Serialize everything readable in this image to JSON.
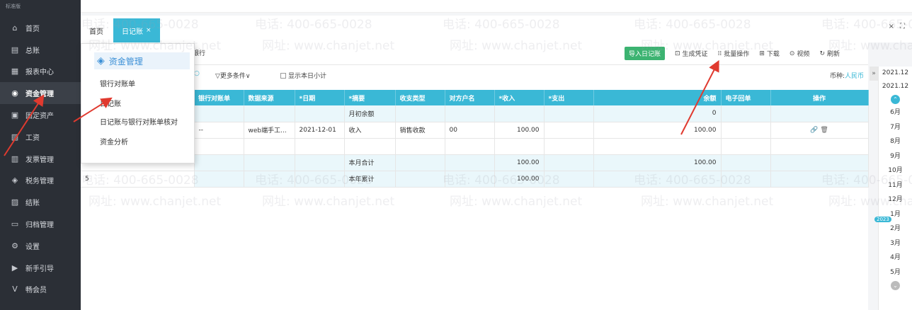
{
  "sidebar": {
    "brand": "标准版",
    "items": [
      {
        "icon": "home-icon",
        "glyph": "⌂",
        "label": "首页"
      },
      {
        "icon": "ledger-icon",
        "glyph": "▤",
        "label": "总账"
      },
      {
        "icon": "chart-icon",
        "glyph": "▦",
        "label": "报表中心"
      },
      {
        "icon": "money-icon",
        "glyph": "◉",
        "label": "资金管理"
      },
      {
        "icon": "asset-icon",
        "glyph": "▣",
        "label": "固定资产"
      },
      {
        "icon": "salary-icon",
        "glyph": "▧",
        "label": "工资"
      },
      {
        "icon": "invoice-icon",
        "glyph": "▥",
        "label": "发票管理"
      },
      {
        "icon": "tax-icon",
        "glyph": "◈",
        "label": "税务管理"
      },
      {
        "icon": "close-account-icon",
        "glyph": "▨",
        "label": "结账"
      },
      {
        "icon": "archive-icon",
        "glyph": "▭",
        "label": "归档管理"
      },
      {
        "icon": "settings-icon",
        "glyph": "⚙",
        "label": "设置"
      },
      {
        "icon": "guide-icon",
        "glyph": "▶",
        "label": "新手引导"
      },
      {
        "icon": "vip-icon",
        "glyph": "V",
        "label": "畅会员"
      }
    ]
  },
  "tabs": {
    "home": "首页",
    "journal": "日记账",
    "close_glyph": "×"
  },
  "window": {
    "close": "×",
    "fullscreen": "⛶"
  },
  "subtab": {
    "bank": "银行"
  },
  "toolbar": {
    "import": "导入日记账",
    "voucher": "生成凭证",
    "batch": "批量操作",
    "download": "下载",
    "video": "视频",
    "refresh": "刷新"
  },
  "filters": {
    "more": "▽更多条件∨",
    "show_daily": "显示本日小计",
    "currency_label": "币种:",
    "currency_value": "人民币"
  },
  "table": {
    "headers": [
      "银行对账单",
      "数据来源",
      "*日期",
      "*摘要",
      "收支类型",
      "对方户名",
      "*收入",
      "*支出",
      "余额",
      "电子回单",
      "操作"
    ],
    "rows": [
      {
        "cells": [
          "",
          "",
          "",
          "月初余额",
          "",
          "",
          "",
          "",
          "0",
          "",
          ""
        ],
        "style": "light"
      },
      {
        "cells": [
          "--",
          "web端手工...",
          "2021-12-01",
          "收入",
          "销售收款",
          "00",
          "100.00",
          "",
          "100.00",
          "",
          "🔗 🗑"
        ],
        "style": "white"
      },
      {
        "cells": [
          "",
          "",
          "",
          "",
          "",
          "",
          "",
          "",
          "",
          "",
          ""
        ],
        "style": "white"
      },
      {
        "cells": [
          "",
          "",
          "",
          "本月合计",
          "",
          "",
          "100.00",
          "",
          "100.00",
          "",
          ""
        ],
        "style": "light"
      },
      {
        "cells": [
          "",
          "",
          "",
          "本年累计",
          "",
          "",
          "100.00",
          "",
          "",
          "",
          ""
        ],
        "style": "light"
      }
    ],
    "row_number": "5"
  },
  "menu": {
    "title": "资金管理",
    "items": [
      "银行对账单",
      "日记账",
      "日记账与银行对账单核对",
      "资金分析"
    ]
  },
  "months": {
    "top": [
      "2021.12",
      "2021.12"
    ],
    "list": [
      "6月",
      "7月",
      "8月",
      "9月",
      "10月",
      "11月",
      "12月",
      "1月",
      "2月",
      "3月",
      "4月",
      "5月"
    ],
    "year_badge": "2023",
    "expand": "»"
  },
  "watermark": {
    "phone": "电话: 400-665-0028",
    "site": "网址: www.chanjet.net"
  },
  "colors": {
    "accent": "#3ab8d6",
    "sidebar": "#2b2f36",
    "import_button": "#3cb371",
    "arrow": "#e03a2f"
  }
}
